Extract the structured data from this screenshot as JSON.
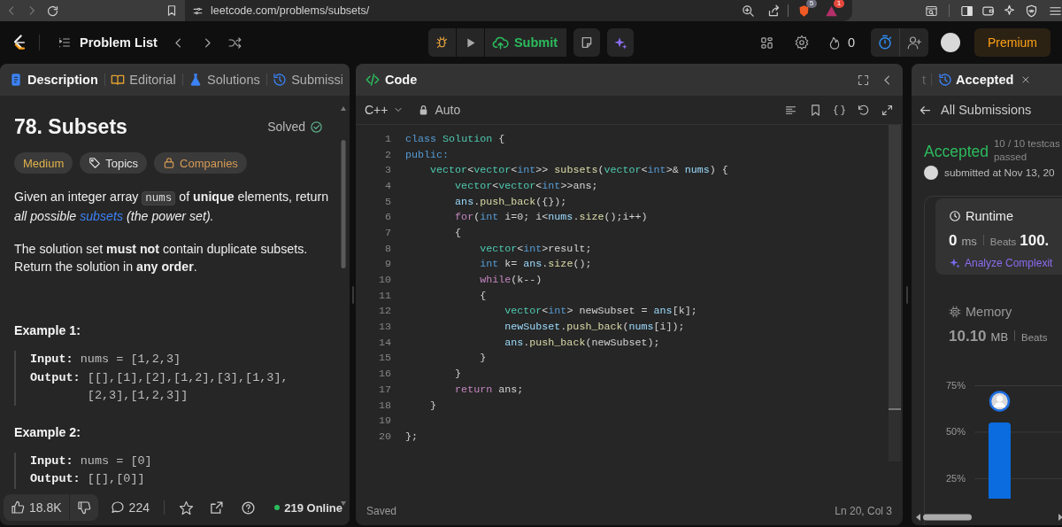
{
  "browser": {
    "address": "leetcode.com/problems/subsets/",
    "extension_badges": [
      "5",
      "1"
    ]
  },
  "header": {
    "title": "Problem List",
    "submit": "Submit",
    "streak": "0",
    "premium": "Premium"
  },
  "description": {
    "tabs": [
      {
        "label": "Description",
        "kind": "description",
        "selected": true
      },
      {
        "label": "Editorial",
        "kind": "editorial",
        "selected": false
      },
      {
        "label": "Solutions",
        "kind": "solutions",
        "selected": false
      },
      {
        "label": "Submissi",
        "kind": "submissions",
        "selected": false
      }
    ],
    "title": "78. Subsets",
    "status": "Solved",
    "tags": [
      {
        "label": "Medium",
        "kind": "difficulty"
      },
      {
        "label": "Topics",
        "kind": "topics"
      },
      {
        "label": "Companies",
        "kind": "companies"
      }
    ],
    "paragraphs": [
      {
        "parts": [
          {
            "text": "Given an integer array ",
            "kind": "plain"
          },
          {
            "text": "nums",
            "kind": "code"
          },
          {
            "text": " of ",
            "kind": "plain"
          },
          {
            "text": "unique",
            "kind": "bold"
          },
          {
            "text": " elements, return ",
            "kind": "plain"
          },
          {
            "text": "all possible ",
            "kind": "italic"
          },
          {
            "text": "subsets",
            "kind": "link"
          },
          {
            "text": " (the power set).",
            "kind": "italic"
          }
        ]
      },
      {
        "parts": [
          {
            "text": "The solution set ",
            "kind": "plain"
          },
          {
            "text": "must not",
            "kind": "bold"
          },
          {
            "text": " contain duplicate subsets. Return the solution in ",
            "kind": "plain"
          },
          {
            "text": "any order",
            "kind": "bold"
          },
          {
            "text": ".",
            "kind": "plain"
          }
        ]
      }
    ],
    "examples": [
      {
        "title": "Example 1:",
        "lines": [
          {
            "label": "Input:",
            "value": "nums = [1,2,3]"
          },
          {
            "label": "Output:",
            "value": "[[],[1],[2],[1,2],[3],[1,3],[2,3],[1,2,3]]"
          }
        ]
      },
      {
        "title": "Example 2:",
        "lines": [
          {
            "label": "Input:",
            "value": "nums = [0]"
          },
          {
            "label": "Output:",
            "value": "[[],[0]]"
          }
        ]
      }
    ],
    "footer": {
      "likes": "18.8K",
      "comments": "224",
      "online": "219 Online"
    }
  },
  "code": {
    "title": "Code",
    "language": "C++",
    "mode": "Auto",
    "status": "Saved",
    "cursor": "Ln 20, Col 3",
    "lines": [
      {
        "number": "1",
        "tokens": [
          {
            "text": "class",
            "kind": "keyword"
          },
          {
            "text": " Solution",
            "kind": "type"
          },
          {
            "text": " {",
            "kind": "plain"
          }
        ]
      },
      {
        "number": "2",
        "tokens": [
          {
            "text": "public:",
            "kind": "keyword"
          }
        ]
      },
      {
        "number": "3",
        "tokens": [
          {
            "text": "    vector",
            "kind": "type"
          },
          {
            "text": "<",
            "kind": "plain"
          },
          {
            "text": "vector",
            "kind": "type"
          },
          {
            "text": "<",
            "kind": "plain"
          },
          {
            "text": "int",
            "kind": "keyword"
          },
          {
            "text": ">> ",
            "kind": "plain"
          },
          {
            "text": "subsets",
            "kind": "function"
          },
          {
            "text": "(",
            "kind": "plain"
          },
          {
            "text": "vector",
            "kind": "type"
          },
          {
            "text": "<",
            "kind": "plain"
          },
          {
            "text": "int",
            "kind": "keyword"
          },
          {
            "text": ">& ",
            "kind": "plain"
          },
          {
            "text": "nums",
            "kind": "variable"
          },
          {
            "text": ") {",
            "kind": "plain"
          }
        ]
      },
      {
        "number": "4",
        "tokens": [
          {
            "text": "        vector",
            "kind": "type"
          },
          {
            "text": "<",
            "kind": "plain"
          },
          {
            "text": "vector",
            "kind": "type"
          },
          {
            "text": "<",
            "kind": "plain"
          },
          {
            "text": "int",
            "kind": "keyword"
          },
          {
            "text": ">>ans;",
            "kind": "plain"
          }
        ]
      },
      {
        "number": "5",
        "tokens": [
          {
            "text": "        ans",
            "kind": "variable"
          },
          {
            "text": ".",
            "kind": "plain"
          },
          {
            "text": "push_back",
            "kind": "function"
          },
          {
            "text": "({});",
            "kind": "plain"
          }
        ]
      },
      {
        "number": "6",
        "tokens": [
          {
            "text": "        for",
            "kind": "control"
          },
          {
            "text": "(",
            "kind": "plain"
          },
          {
            "text": "int",
            "kind": "keyword"
          },
          {
            "text": " i=0; i<",
            "kind": "plain"
          },
          {
            "text": "nums",
            "kind": "variable"
          },
          {
            "text": ".",
            "kind": "plain"
          },
          {
            "text": "size",
            "kind": "function"
          },
          {
            "text": "();i++)",
            "kind": "plain"
          }
        ]
      },
      {
        "number": "7",
        "tokens": [
          {
            "text": "        {",
            "kind": "plain"
          }
        ]
      },
      {
        "number": "8",
        "tokens": [
          {
            "text": "            vector",
            "kind": "type"
          },
          {
            "text": "<",
            "kind": "plain"
          },
          {
            "text": "int",
            "kind": "keyword"
          },
          {
            "text": ">result;",
            "kind": "plain"
          }
        ]
      },
      {
        "number": "9",
        "tokens": [
          {
            "text": "            int",
            "kind": "keyword"
          },
          {
            "text": " k= ",
            "kind": "plain"
          },
          {
            "text": "ans",
            "kind": "variable"
          },
          {
            "text": ".",
            "kind": "plain"
          },
          {
            "text": "size",
            "kind": "function"
          },
          {
            "text": "();",
            "kind": "plain"
          }
        ]
      },
      {
        "number": "10",
        "tokens": [
          {
            "text": "            while",
            "kind": "control"
          },
          {
            "text": "(k--)",
            "kind": "plain"
          }
        ]
      },
      {
        "number": "11",
        "tokens": [
          {
            "text": "            {",
            "kind": "plain"
          }
        ]
      },
      {
        "number": "12",
        "tokens": [
          {
            "text": "                vector",
            "kind": "type"
          },
          {
            "text": "<",
            "kind": "plain"
          },
          {
            "text": "int",
            "kind": "keyword"
          },
          {
            "text": "> newSubset = ",
            "kind": "plain"
          },
          {
            "text": "ans",
            "kind": "variable"
          },
          {
            "text": "[k];",
            "kind": "plain"
          }
        ]
      },
      {
        "number": "13",
        "tokens": [
          {
            "text": "                newSubset",
            "kind": "variable"
          },
          {
            "text": ".",
            "kind": "plain"
          },
          {
            "text": "push_back",
            "kind": "function"
          },
          {
            "text": "(",
            "kind": "plain"
          },
          {
            "text": "nums",
            "kind": "variable"
          },
          {
            "text": "[i]);",
            "kind": "plain"
          }
        ]
      },
      {
        "number": "14",
        "tokens": [
          {
            "text": "                ans",
            "kind": "variable"
          },
          {
            "text": ".",
            "kind": "plain"
          },
          {
            "text": "push_back",
            "kind": "function"
          },
          {
            "text": "(newSubset);",
            "kind": "plain"
          }
        ]
      },
      {
        "number": "15",
        "tokens": [
          {
            "text": "            }",
            "kind": "plain"
          }
        ]
      },
      {
        "number": "16",
        "tokens": [
          {
            "text": "        }",
            "kind": "plain"
          }
        ]
      },
      {
        "number": "17",
        "tokens": [
          {
            "text": "        return",
            "kind": "control"
          },
          {
            "text": " ans;",
            "kind": "plain"
          }
        ]
      },
      {
        "number": "18",
        "tokens": [
          {
            "text": "    }",
            "kind": "plain"
          }
        ]
      },
      {
        "number": "19"
      },
      {
        "number": "20",
        "tokens": [
          {
            "text": "};",
            "kind": "plain"
          }
        ]
      }
    ]
  },
  "result": {
    "tabs": [
      {
        "label": "t",
        "selected": false
      },
      {
        "label": "Accepted",
        "selected": true
      }
    ],
    "back": "All Submissions",
    "verdict": "Accepted",
    "testcases": [
      "10 / 10 testcas",
      "passed"
    ],
    "submitted": "submitted at Nov 13, 20",
    "runtime": {
      "title": "Runtime",
      "value": "0",
      "unit": "ms",
      "beats_label": "Beats",
      "beats": "100.",
      "analyze": "Analyze Complexit"
    },
    "memory": {
      "title": "Memory",
      "value": "10.10",
      "unit": "MB",
      "beats_label": "Beats"
    },
    "chart_data": {
      "type": "bar",
      "values": [
        55
      ],
      "ylim": [
        14,
        75
      ],
      "grid": true,
      "yticks": [
        {
          "value": 25,
          "label": "25%"
        },
        {
          "value": 50,
          "label": "50%"
        },
        {
          "value": 75,
          "label": "75%"
        }
      ]
    }
  }
}
